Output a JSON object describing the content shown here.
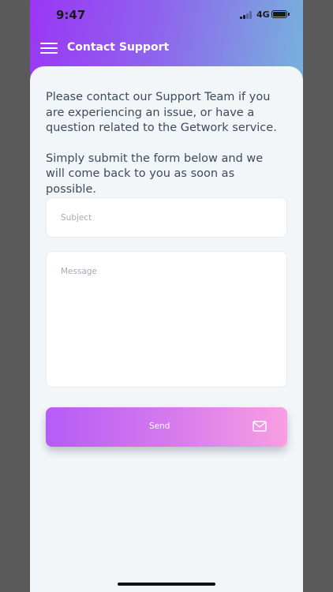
{
  "status_bar": {
    "time": "9:47",
    "network": "4G",
    "signal_bars_active": 2,
    "battery_level": 1.0
  },
  "header": {
    "title": "Contact Support",
    "menu_icon": "hamburger-menu-icon"
  },
  "intro": {
    "paragraph_1": "Please contact our Support Team if you are experiencing an issue, or have a question related to the Getwork service.",
    "paragraph_2": "Simply submit the form below and we will come back to you as soon as possible."
  },
  "form": {
    "subject": {
      "placeholder": "Subject",
      "value": ""
    },
    "message": {
      "placeholder": "Message",
      "value": ""
    },
    "send_button": {
      "label": "Send",
      "icon": "mail-icon"
    }
  },
  "colors": {
    "header_gradient_start": "#9b36f5",
    "header_gradient_end": "#6fd6cf",
    "button_gradient_start": "#b45cf6",
    "button_gradient_end": "#f99fe1",
    "content_background": "#f2f6f9",
    "body_text": "#3e4a5c",
    "placeholder_text": "#a2abb8"
  }
}
